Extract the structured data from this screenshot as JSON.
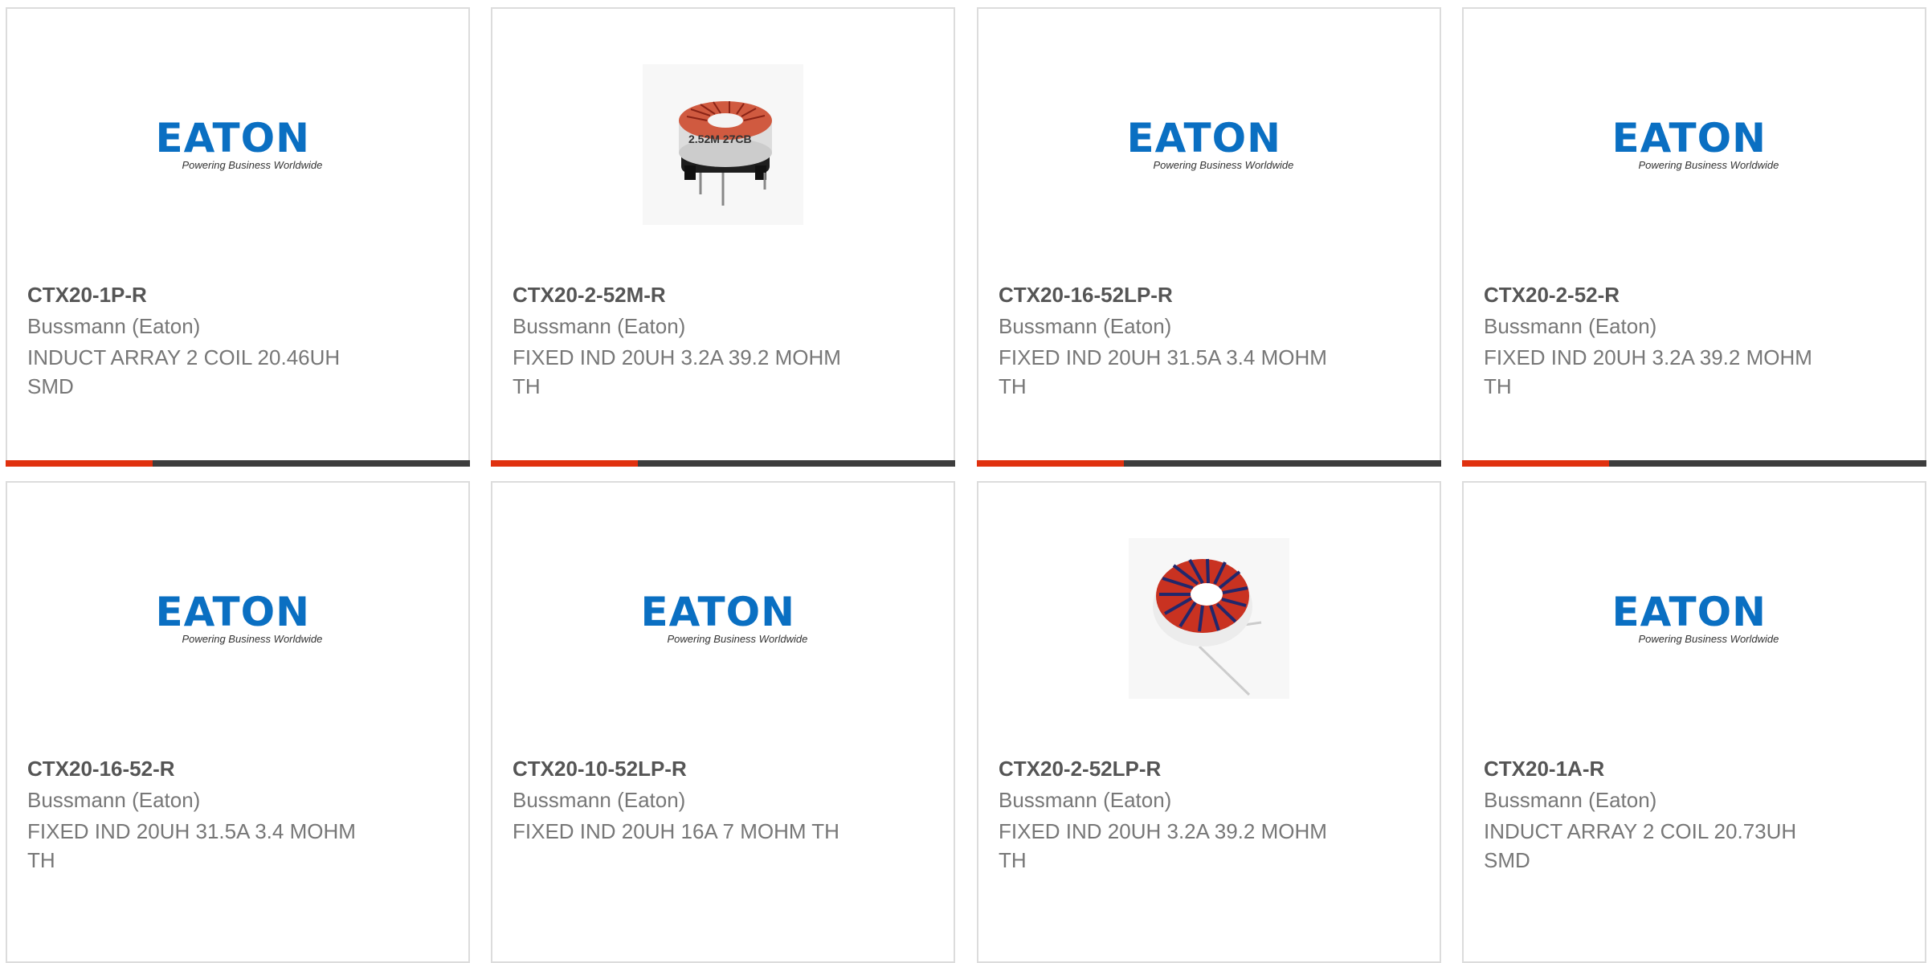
{
  "logo": {
    "word": "EATON",
    "tagline": "Powering Business Worldwide"
  },
  "colors": {
    "accent": "#e0310f",
    "bar": "#3d3d3d",
    "brand": "#0a6fc2"
  },
  "products": [
    {
      "part": "CTX20-1P-R",
      "maker": "Bussmann (Eaton)",
      "desc": "INDUCT ARRAY 2 COIL 20.46UH SMD",
      "image": "eaton-logo"
    },
    {
      "part": "CTX20-2-52M-R",
      "maker": "Bussmann (Eaton)",
      "desc": "FIXED IND 20UH 3.2A 39.2 MOHM TH",
      "image": "toroid-inductor-base",
      "image_text": "2.52M 27CB"
    },
    {
      "part": "CTX20-16-52LP-R",
      "maker": "Bussmann (Eaton)",
      "desc": "FIXED IND 20UH 31.5A 3.4 MOHM TH",
      "image": "eaton-logo"
    },
    {
      "part": "CTX20-2-52-R",
      "maker": "Bussmann (Eaton)",
      "desc": "FIXED IND 20UH 3.2A 39.2 MOHM TH",
      "image": "eaton-logo"
    },
    {
      "part": "CTX20-16-52-R",
      "maker": "Bussmann (Eaton)",
      "desc": "FIXED IND 20UH 31.5A 3.4 MOHM TH",
      "image": "eaton-logo"
    },
    {
      "part": "CTX20-10-52LP-R",
      "maker": "Bussmann (Eaton)",
      "desc": "FIXED IND 20UH 16A 7 MOHM TH",
      "image": "eaton-logo"
    },
    {
      "part": "CTX20-2-52LP-R",
      "maker": "Bussmann (Eaton)",
      "desc": "FIXED IND 20UH 3.2A 39.2 MOHM TH",
      "image": "toroid-inductor"
    },
    {
      "part": "CTX20-1A-R",
      "maker": "Bussmann (Eaton)",
      "desc": "INDUCT ARRAY 2 COIL 20.73UH SMD",
      "image": "eaton-logo"
    }
  ]
}
